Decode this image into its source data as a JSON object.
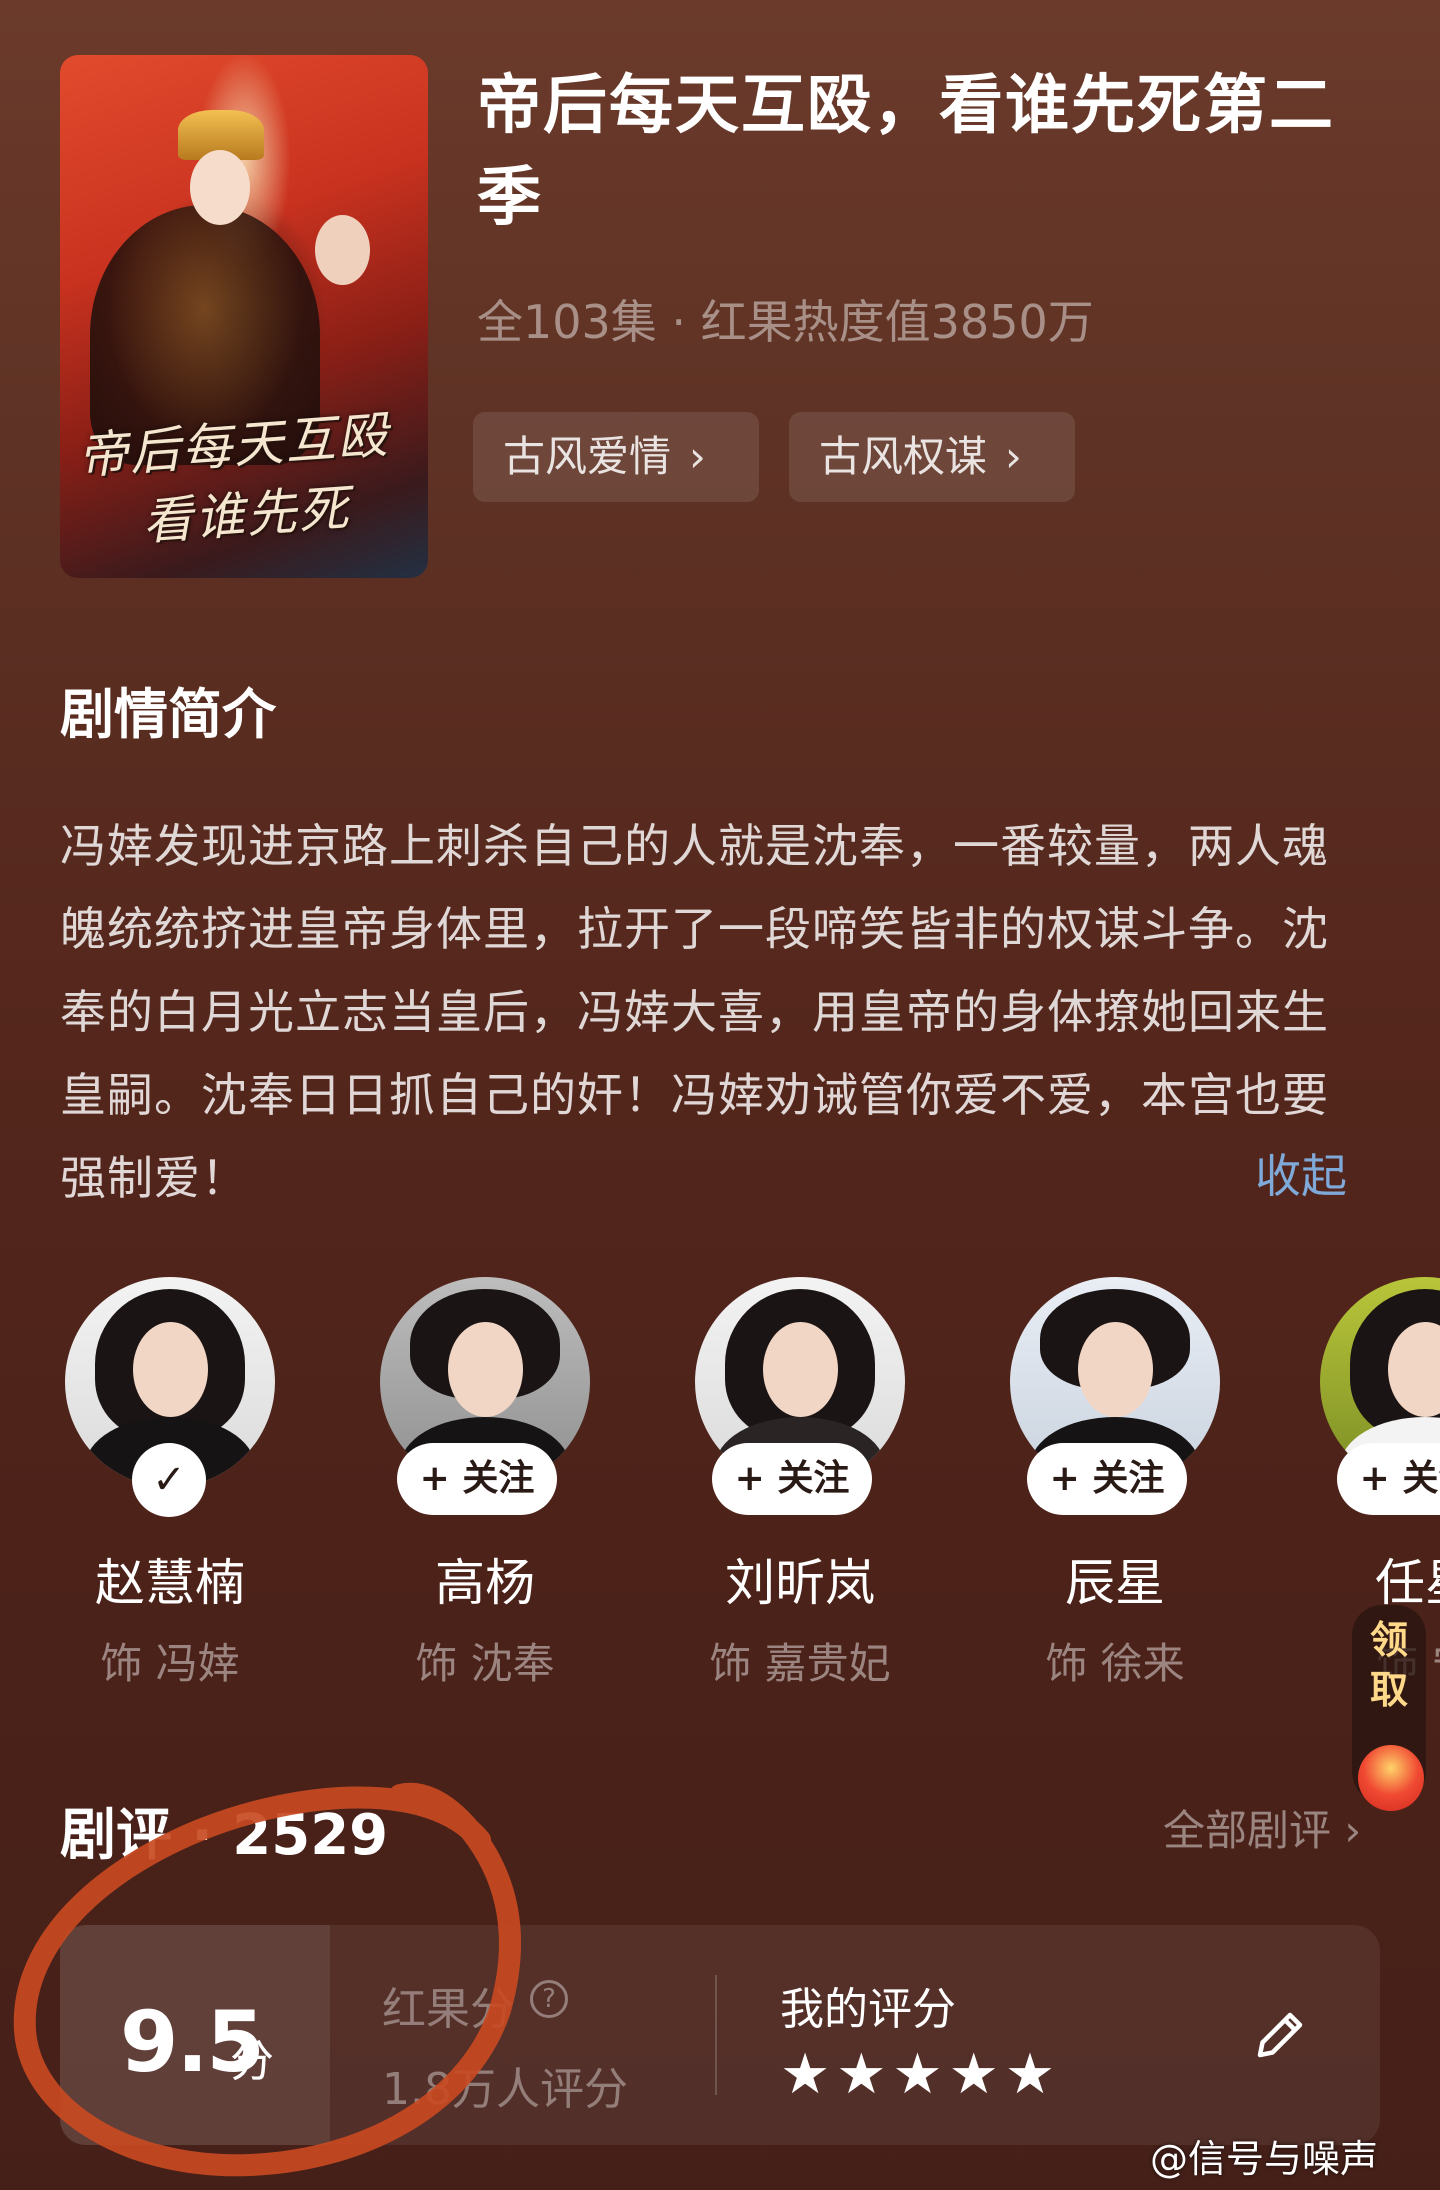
{
  "drama": {
    "title": "帝后每天互殴，看谁先死第二季",
    "meta": "全103集 · 红果热度值3850万",
    "poster_text_line1": "帝后每天互殴",
    "poster_text_line2": "看谁先死",
    "tags": [
      {
        "label": "古风爱情"
      },
      {
        "label": "古风权谋"
      }
    ]
  },
  "synopsis": {
    "title": "剧情简介",
    "text": "冯婞发现进京路上刺杀自己的人就是沈奉，一番较量，两人魂魄统统挤进皇帝身体里，拉开了一段啼笑皆非的权谋斗争。沈奉的白月光立志当皇后，冯婞大喜，用皇帝的身体撩她回来生皇嗣。沈奉日日抓自己的奸！冯婞劝诫管你爱不爱，本宫也要强制爱！",
    "collapse_label": "收起"
  },
  "cast": [
    {
      "name": "赵慧楠",
      "role": "饰 冯婞",
      "followed": true,
      "follow_label": "✓"
    },
    {
      "name": "高杨",
      "role": "饰 沈奉",
      "followed": false,
      "follow_label": "+ 关注"
    },
    {
      "name": "刘昕岚",
      "role": "饰 嘉贵妃",
      "followed": false,
      "follow_label": "+ 关注"
    },
    {
      "name": "辰星",
      "role": "饰 徐来",
      "followed": false,
      "follow_label": "+ 关注"
    },
    {
      "name": "任星",
      "role": "饰 宁",
      "followed": false,
      "follow_label": "+ 关注"
    }
  ],
  "reward_widget": {
    "label_1": "领",
    "label_2": "取"
  },
  "reviews": {
    "title": "剧评 · 2529",
    "all_label": "全部剧评 ›",
    "score": "9.5",
    "score_unit": "分",
    "score_label": "红果分",
    "help_icon": "?",
    "rating_count": "1.8万人评分",
    "my_rating_label": "我的评分",
    "my_rating_stars": 5
  },
  "watermark": "@信号与噪声",
  "colors": {
    "background": "#5a2a1f",
    "link": "#7fa9d8",
    "annotation": "#c84a22"
  }
}
